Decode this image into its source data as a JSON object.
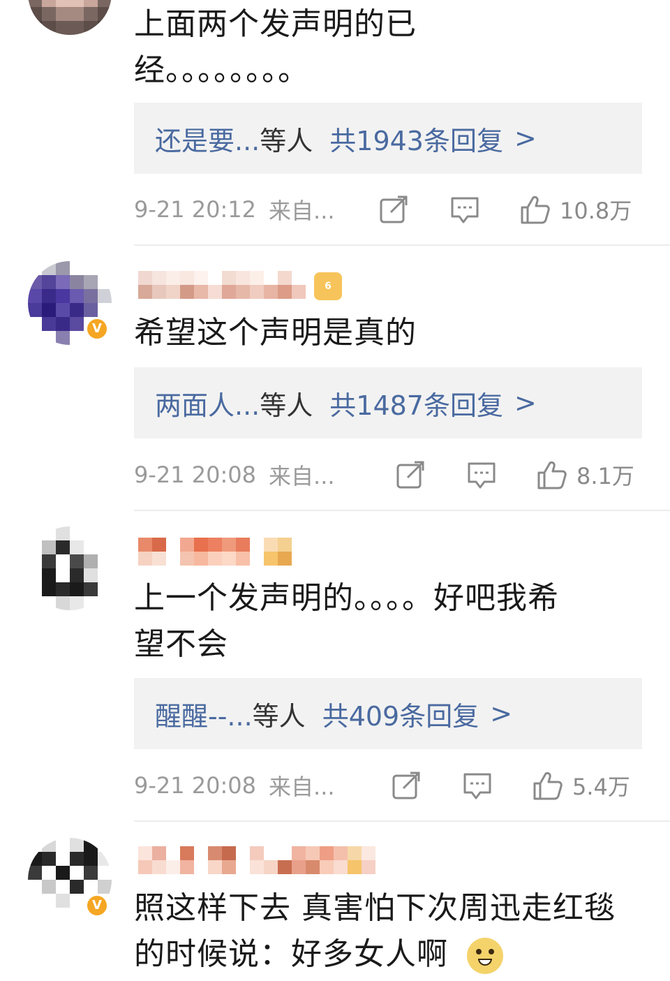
{
  "comments": [
    {
      "text_lines": [
        "上面两个发声明的已",
        "经。。。。。。。。"
      ],
      "reply": {
        "names": "还是要...",
        "etc": "等人",
        "count": "共1943条回复",
        "arrow": ">"
      },
      "time": "9-21 20:12",
      "source": "来自...",
      "likes": "10.8万"
    },
    {
      "text_lines": [
        "希望这个声明是真的"
      ],
      "reply": {
        "names": "两面人...",
        "etc": "等人",
        "count": "共1487条回复",
        "arrow": ">"
      },
      "time": "9-21 20:08",
      "source": "来自...",
      "likes": "8.1万"
    },
    {
      "text_lines": [
        "上一个发声明的。。。。好吧我希",
        "望不会"
      ],
      "reply": {
        "names": "醒醒--...",
        "etc": "等人",
        "count": "共409条回复",
        "arrow": ">"
      },
      "time": "9-21 20:08",
      "source": "来自...",
      "likes": "5.4万"
    },
    {
      "text_lines": [
        "照这样下去 真害怕下次周迅走红毯",
        "的时候说：好多女人啊"
      ]
    }
  ],
  "icons": {
    "share": "share-icon",
    "comment": "comment-icon",
    "like": "like-icon",
    "verified": "verified-badge-icon",
    "emoji": "doge-emoji-icon"
  },
  "badges": {
    "verified": "V",
    "level": "6"
  },
  "colors": {
    "link": "#4a6aa0",
    "meta": "#9a9a9a",
    "reply_bg": "#f2f2f2",
    "verified": "#f5a623"
  }
}
